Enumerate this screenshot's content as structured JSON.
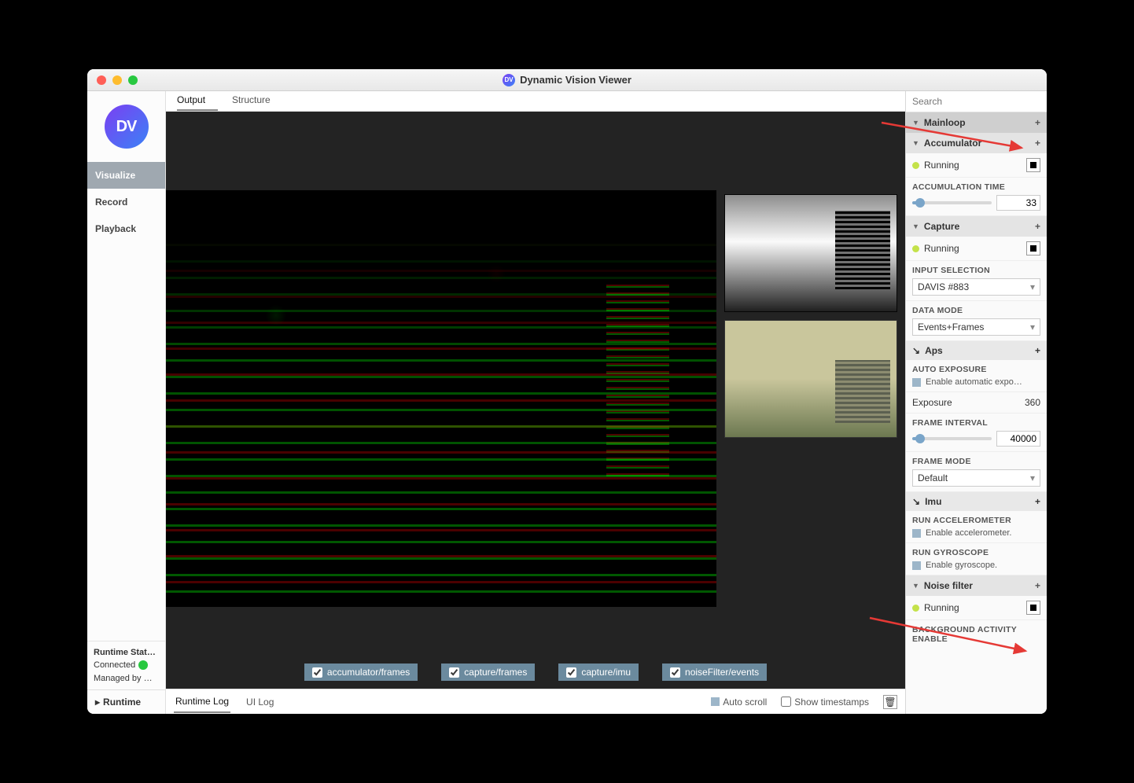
{
  "window": {
    "title": "Dynamic Vision Viewer",
    "app_icon_label": "DV"
  },
  "left_nav": {
    "logo_text": "DV",
    "items": [
      {
        "label": "Visualize",
        "active": true
      },
      {
        "label": "Record",
        "active": false
      },
      {
        "label": "Playback",
        "active": false
      }
    ],
    "runtime_status_label": "Runtime Stat…",
    "connected_label": "Connected",
    "managed_label": "Managed by …",
    "runtime_button": "Runtime"
  },
  "tabs": {
    "output": "Output",
    "structure": "Structure"
  },
  "streams": {
    "s0": "accumulator/frames",
    "s1": "capture/frames",
    "s2": "capture/imu",
    "s3": "noiseFilter/events"
  },
  "log": {
    "runtime_log": "Runtime Log",
    "ui_log": "UI Log",
    "auto_scroll": "Auto scroll",
    "show_timestamps": "Show timestamps"
  },
  "right": {
    "search_placeholder": "Search",
    "mainloop": {
      "title": "Mainloop"
    },
    "accumulator": {
      "title": "Accumulator",
      "running_label": "Running",
      "acc_time_label": "ACCUMULATION TIME",
      "acc_time_value": "33"
    },
    "capture": {
      "title": "Capture",
      "running_label": "Running",
      "input_selection_label": "INPUT SELECTION",
      "input_selection_value": "DAVIS #883",
      "data_mode_label": "DATA MODE",
      "data_mode_value": "Events+Frames"
    },
    "aps": {
      "title": "Aps",
      "auto_exposure_label": "AUTO EXPOSURE",
      "auto_exposure_desc": "Enable automatic expo…",
      "exposure_label": "Exposure",
      "exposure_value": "360",
      "frame_interval_label": "FRAME INTERVAL",
      "frame_interval_value": "40000",
      "frame_mode_label": "FRAME MODE",
      "frame_mode_value": "Default"
    },
    "imu": {
      "title": "Imu",
      "run_accel_label": "RUN ACCELEROMETER",
      "run_accel_desc": "Enable accelerometer.",
      "run_gyro_label": "RUN GYROSCOPE",
      "run_gyro_desc": "Enable gyroscope."
    },
    "noise": {
      "title": "Noise filter",
      "running_label": "Running",
      "bg_activity_label": "BACKGROUND ACTIVITY ENABLE"
    }
  }
}
